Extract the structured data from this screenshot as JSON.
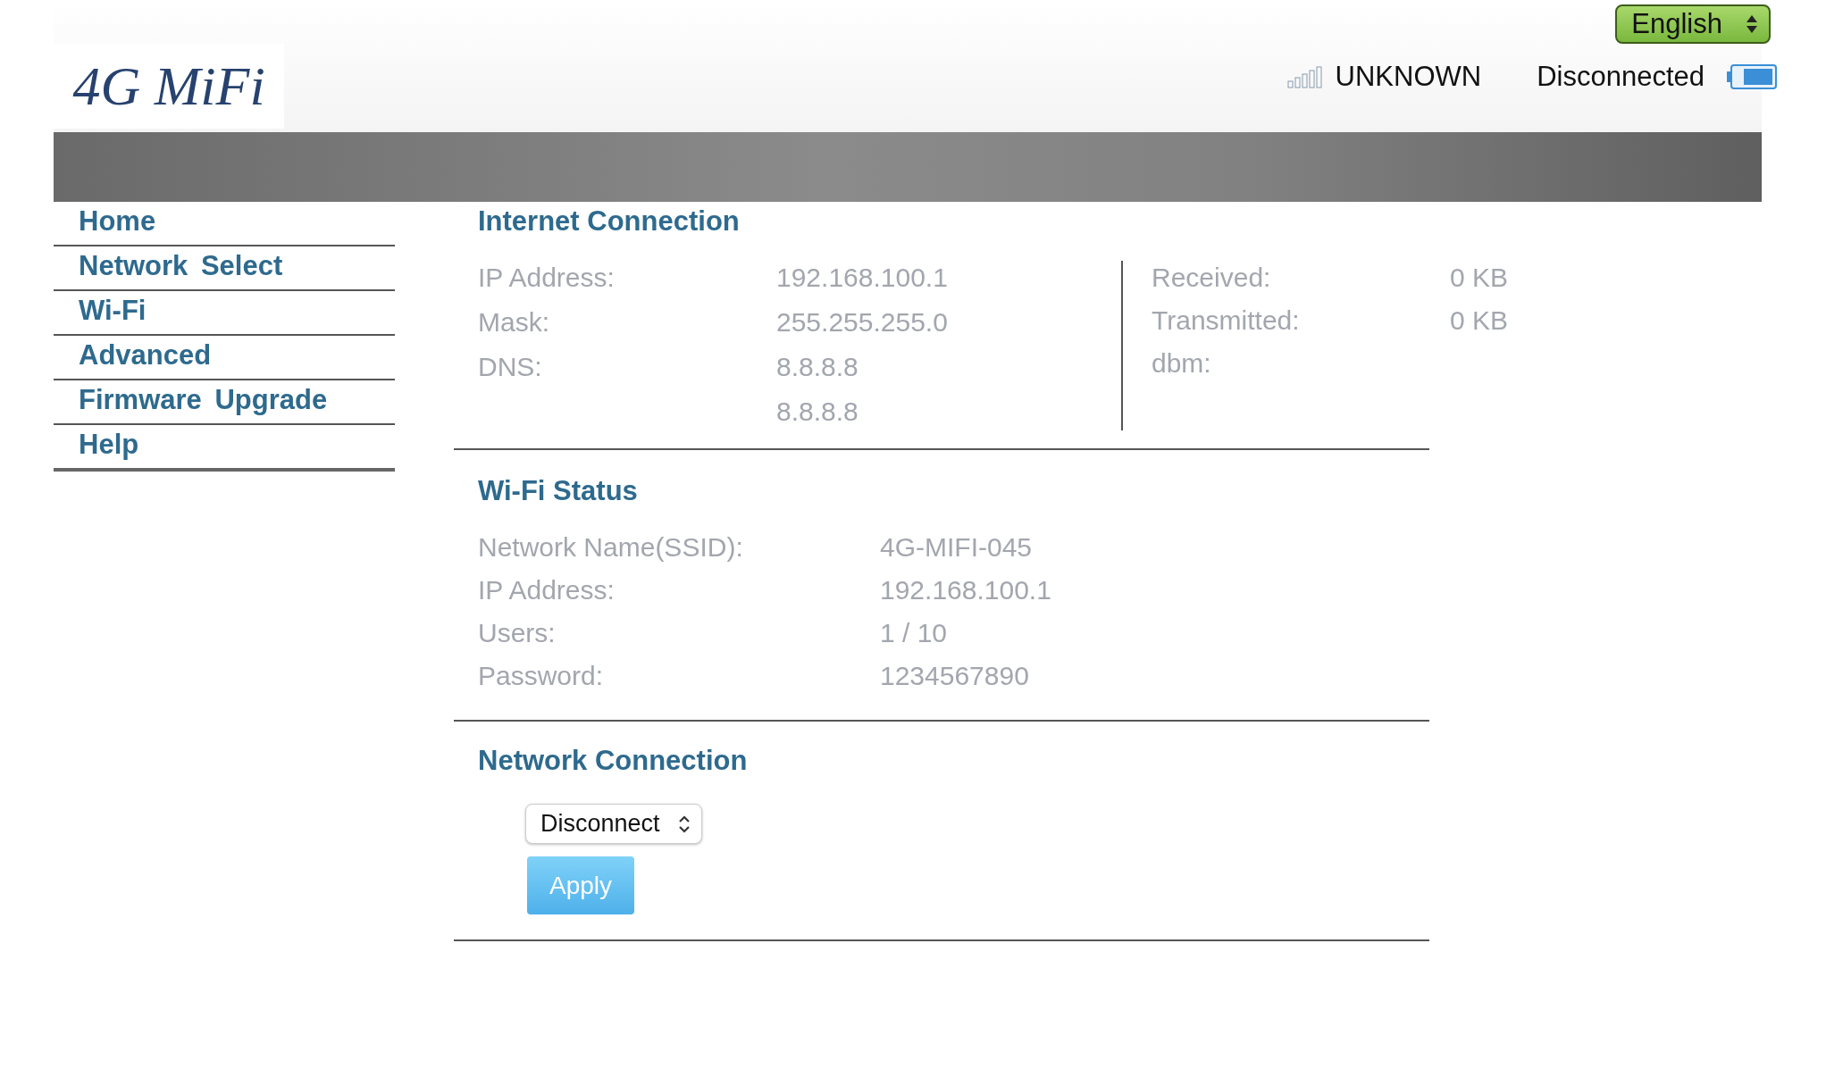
{
  "header": {
    "language": "English",
    "logo": "4G MiFi",
    "signal_status": "UNKNOWN",
    "connection_status": "Disconnected"
  },
  "nav": [
    "Home",
    "Network Select",
    "Wi-Fi",
    "Advanced",
    "Firmware Upgrade",
    "Help"
  ],
  "internet_connection": {
    "title": "Internet Connection",
    "left": [
      {
        "label": "IP Address:",
        "value": "192.168.100.1"
      },
      {
        "label": "Mask:",
        "value": "255.255.255.0"
      },
      {
        "label": "DNS:",
        "value": "8.8.8.8"
      },
      {
        "value": "8.8.8.8"
      }
    ],
    "right": [
      {
        "label": "Received:",
        "value": "0 KB"
      },
      {
        "label": "Transmitted:",
        "value": "0 KB"
      },
      {
        "label": "dbm:"
      }
    ]
  },
  "wifi_status": {
    "title": "Wi-Fi Status",
    "rows": [
      {
        "label": "Network Name(SSID):",
        "value": "4G-MIFI-045"
      },
      {
        "label": "IP Address:",
        "value": "192.168.100.1"
      },
      {
        "label": "Users:",
        "value": "1 / 10"
      },
      {
        "label": "Password:",
        "value": "1234567890"
      }
    ]
  },
  "network_connection": {
    "title": "Network Connection",
    "mode": "Disconnect",
    "button": "Apply"
  }
}
